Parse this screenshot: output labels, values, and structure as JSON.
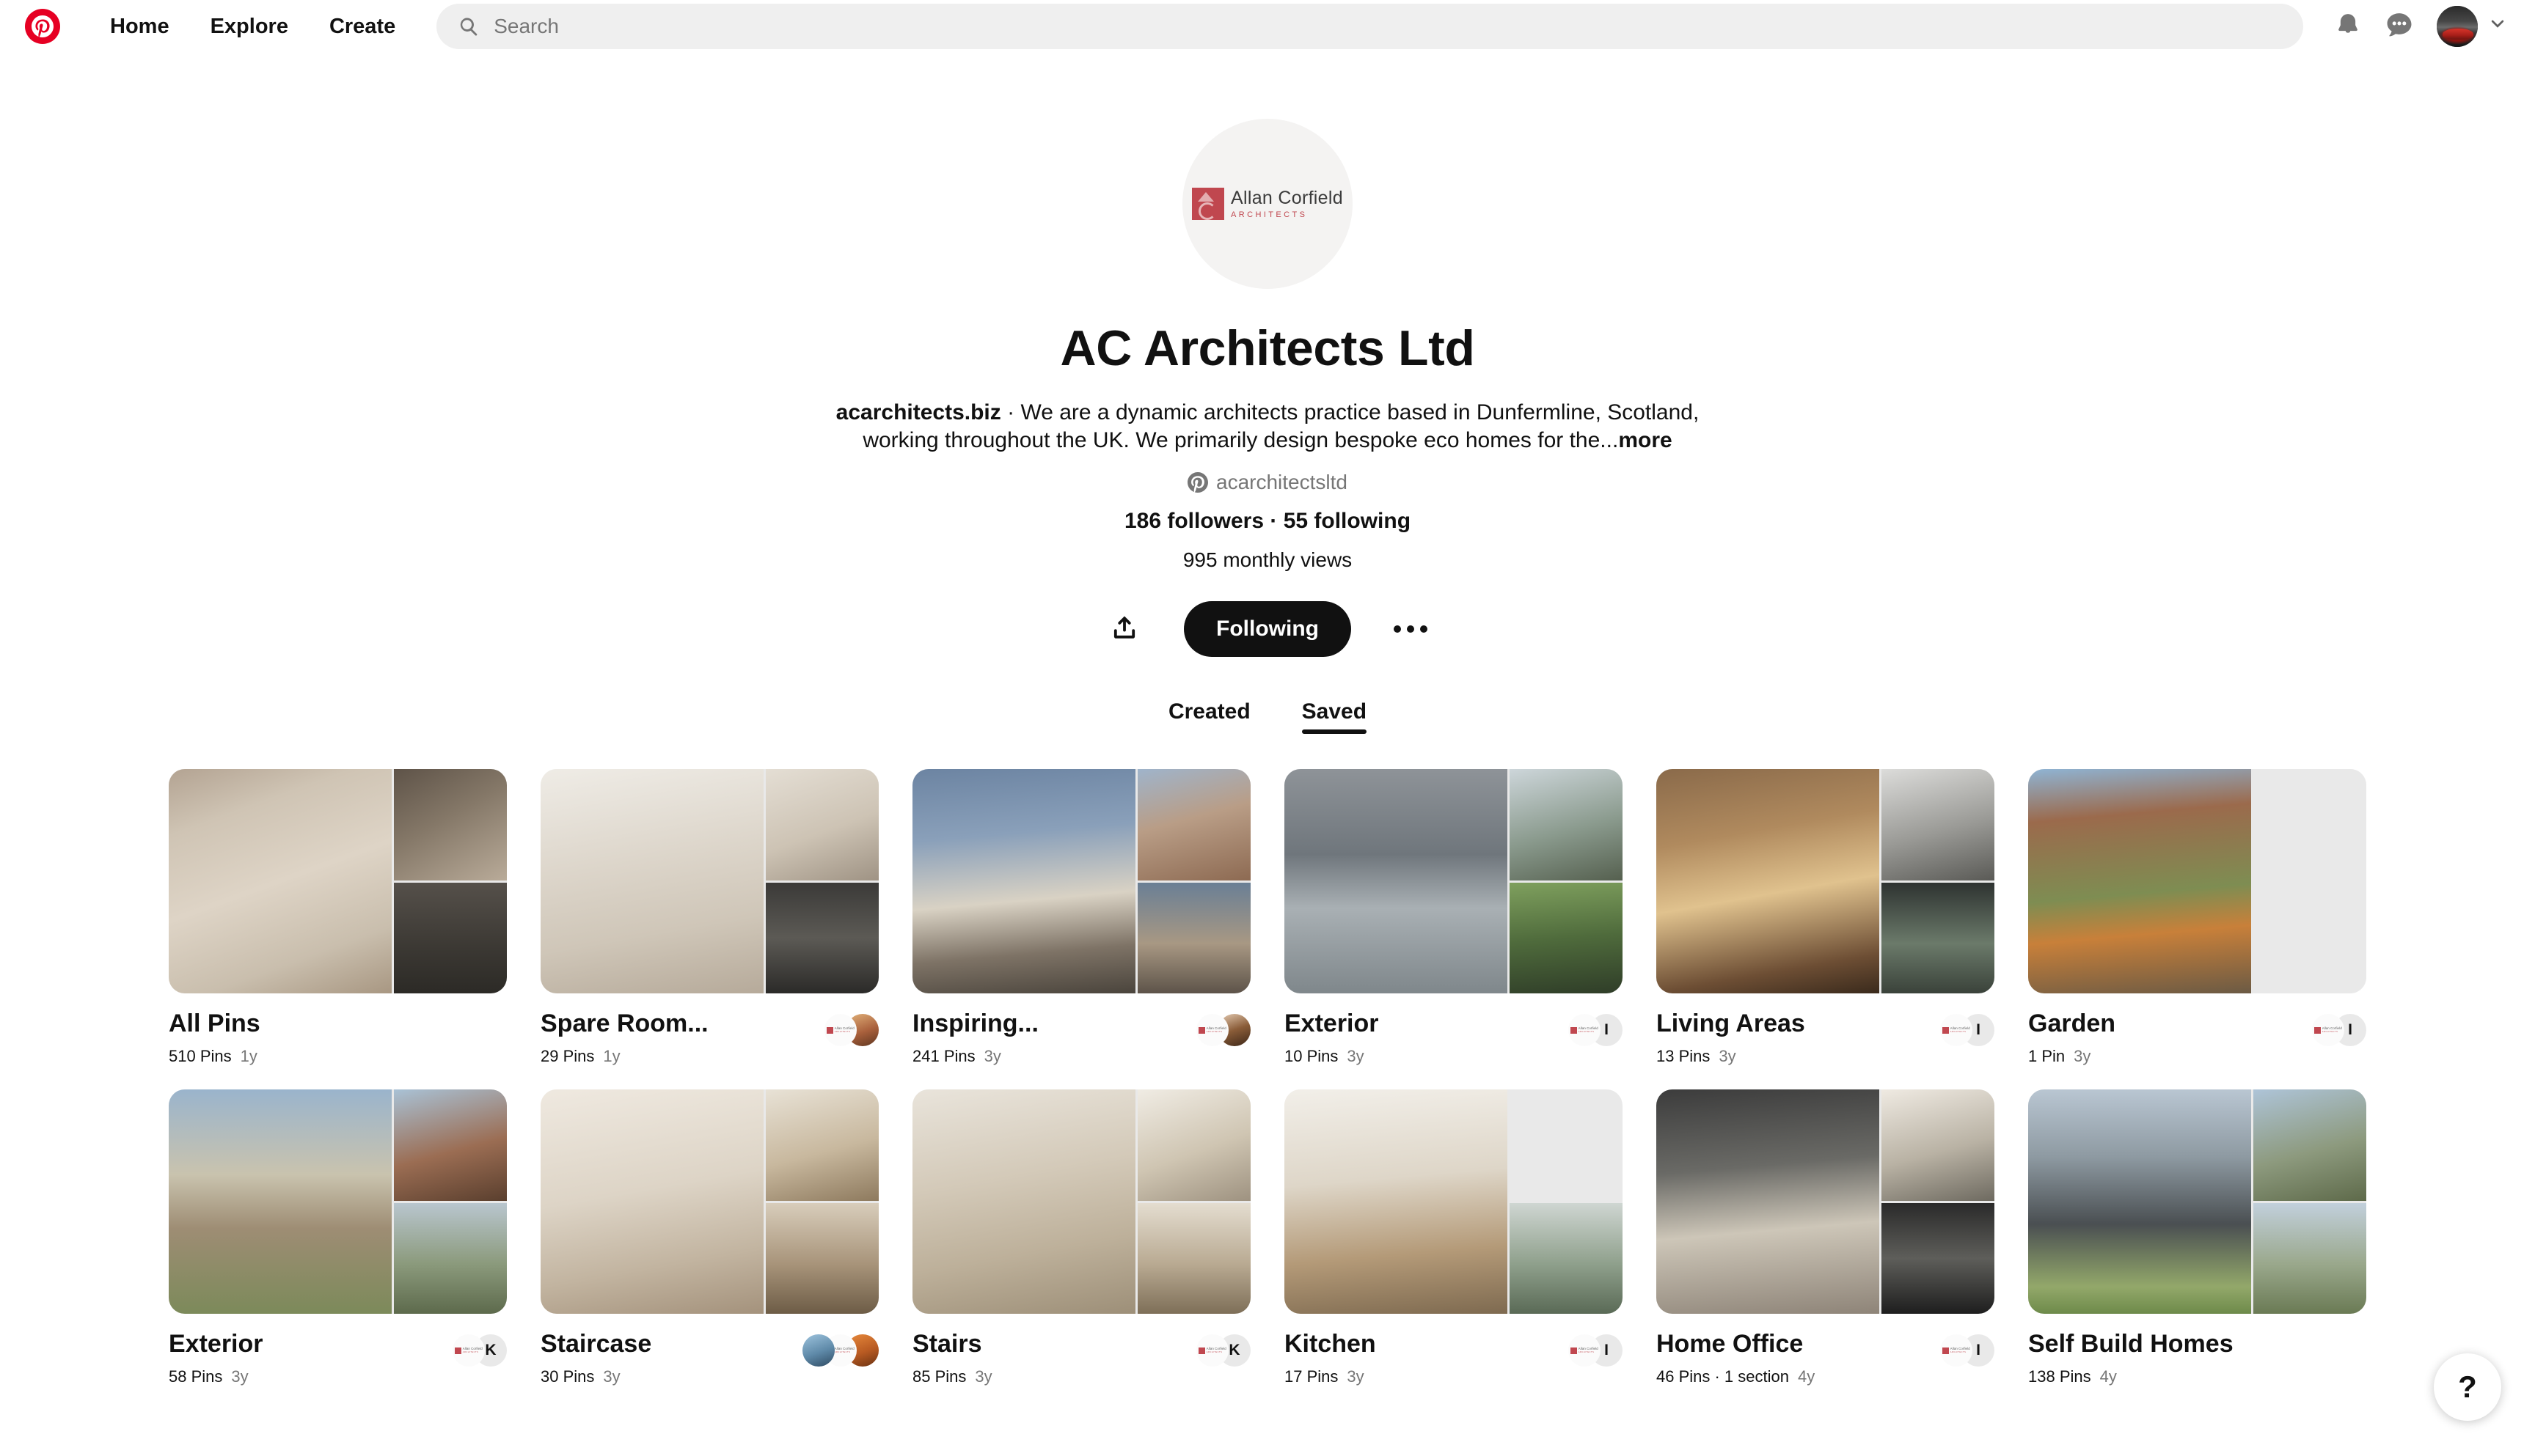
{
  "header": {
    "logo_icon": "pinterest-logo-icon",
    "nav": [
      {
        "label": "Home"
      },
      {
        "label": "Explore"
      },
      {
        "label": "Create"
      }
    ],
    "search": {
      "placeholder": "Search",
      "value": "",
      "icon": "search-icon"
    },
    "notifications_icon": "bell-icon",
    "messages_icon": "chat-bubble-icon",
    "account_chevron_icon": "chevron-down-icon",
    "avatar_alt": "user-avatar"
  },
  "profile": {
    "avatar_logo": {
      "name": "Allan Corfield",
      "subtitle": "ARCHITECTS",
      "mark_color": "#c0474f"
    },
    "name": "AC Architects Ltd",
    "website": "acarchitects.biz",
    "about_separator": " · ",
    "about": "We are a dynamic architects practice based in Dunfermline, Scotland, working throughout the UK. We primarily design bespoke eco homes for the...",
    "more_label": "more",
    "username": "acarchitectsltd",
    "username_icon": "pinterest-badge-icon",
    "stats": "186 followers · 55 following",
    "followers": "186 followers",
    "following": "55 following",
    "monthly_views": "995 monthly views",
    "actions": {
      "share_icon": "share-icon",
      "follow_label": "Following",
      "more_icon": "ellipsis-icon"
    }
  },
  "tabs": [
    {
      "label": "Created",
      "active": false
    },
    {
      "label": "Saved",
      "active": true
    }
  ],
  "boards": [
    {
      "title": "All Pins",
      "pins": "510 Pins",
      "age": "1y",
      "collaborators": [],
      "cover": {
        "main": "linear-gradient(160deg,#b3a392 0%,#cfc4b4 22%,#ded4c6 50%,#c9bead 78%,#a89782 100%)",
        "thumbs": [
          "linear-gradient(150deg,#5e5348 0%,#857868 45%,#b9ab99 100%)",
          "linear-gradient(180deg,#55504a 0%,#3b3833 60%,#2c2a26 100%)"
        ]
      }
    },
    {
      "title": "Spare Room...",
      "pins": "29 Pins",
      "age": "1y",
      "collaborators": [
        "logo",
        "photo-warm"
      ],
      "cover": {
        "main": "linear-gradient(170deg,#efece6 0%,#ddd6cb 40%,#cfc6b8 70%,#b6aa9a 100%)",
        "thumbs": [
          "linear-gradient(160deg,#e4ded4 0%,#cdc3b4 55%,#9f9384 100%)",
          "linear-gradient(180deg,#3b3a38 0%,#5c5a55 50%,#2b2a28 100%)"
        ]
      }
    },
    {
      "title": "Inspiring...",
      "pins": "241 Pins",
      "age": "3y",
      "collaborators": [
        "logo",
        "photo-hair"
      ],
      "cover": {
        "main": "linear-gradient(175deg,#6c84a2 0%,#8aa0ba 30%,#d9d2c4 58%,#7e7366 80%,#4a443c 100%)",
        "thumbs": [
          "linear-gradient(165deg,#9fb4cb 0%,#b99d86 45%,#8d6a52 100%)",
          "linear-gradient(180deg,#6a7f95 0%,#a89883 55%,#5d5349 100%)"
        ]
      }
    },
    {
      "title": "Exterior",
      "pins": "10 Pins",
      "age": "3y",
      "collaborators": [
        "logo",
        "letter-I"
      ],
      "cover": {
        "main": "linear-gradient(180deg,#8e9398 0%,#6f767c 38%,#a9b0b4 62%,#7f878b 100%)",
        "thumbs": [
          "linear-gradient(165deg,#cdd6da 0%,#8a9a8d 55%,#55604f 100%)",
          "linear-gradient(175deg,#7fa05e 0%,#4f6b3c 50%,#2f3d28 100%)"
        ]
      }
    },
    {
      "title": "Living Areas",
      "pins": "13 Pins",
      "age": "3y",
      "collaborators": [
        "logo",
        "letter-I"
      ],
      "cover": {
        "main": "linear-gradient(170deg,#8a6a4a 0%,#b08a5e 30%,#e0c28e 55%,#6d4e34 85%,#3a2a1c 100%)",
        "thumbs": [
          "linear-gradient(165deg,#dcdcda 0%,#9a9a96 55%,#5a5a56 100%)",
          "linear-gradient(180deg,#2e3331 0%,#6b7a6a 55%,#3a423a 100%)"
        ]
      }
    },
    {
      "title": "Garden",
      "pins": "1 Pin",
      "age": "3y",
      "collaborators": [
        "logo",
        "letter-I"
      ],
      "cover": {
        "main": "linear-gradient(175deg,#8fb4d4 0%,#9b6a4c 22%,#7e8d52 55%,#c8803a 72%,#6b5a44 100%)",
        "thumbs": [
          "empty",
          "empty"
        ]
      }
    },
    {
      "title": "Exterior",
      "pins": "58 Pins",
      "age": "3y",
      "collaborators": [
        "logo",
        "letter-K"
      ],
      "cover": {
        "main": "linear-gradient(180deg,#9ab4cc 0%,#c9c3ae 38%,#9e8d74 62%,#7c8a5a 100%)",
        "thumbs": [
          "linear-gradient(165deg,#a9c2d6 0%,#9b6d53 55%,#5a3f2e 100%)",
          "linear-gradient(180deg,#b9c6cf 0%,#8b9a7c 55%,#5d6a4c 100%)"
        ]
      }
    },
    {
      "title": "Staircase",
      "pins": "30 Pins",
      "age": "3y",
      "collaborators": [
        "photo-blue",
        "logo",
        "photo-orange"
      ],
      "cover": {
        "main": "linear-gradient(170deg,#efe9e0 0%,#ddd4c6 45%,#c2b4a0 75%,#a4927c 100%)",
        "thumbs": [
          "linear-gradient(165deg,#e8e2d6 0%,#c8b89e 55%,#8e7a5e 100%)",
          "linear-gradient(180deg,#d8cdbb 0%,#a8947a 55%,#6d5c46 100%)"
        ]
      }
    },
    {
      "title": "Stairs",
      "pins": "85 Pins",
      "age": "3y",
      "collaborators": [
        "logo",
        "letter-K"
      ],
      "cover": {
        "main": "linear-gradient(170deg,#e9e4db 0%,#d3c9b8 40%,#bdb09a 70%,#9d8f78 100%)",
        "thumbs": [
          "linear-gradient(160deg,#f0ece4 0%,#cfc5b2 55%,#9e9280 100%)",
          "linear-gradient(180deg,#e4ddd0 0%,#b9aa92 55%,#7e6f58 100%)"
        ]
      }
    },
    {
      "title": "Kitchen",
      "pins": "17 Pins",
      "age": "3y",
      "collaborators": [
        "logo",
        "letter-I"
      ],
      "cover": {
        "main": "linear-gradient(175deg,#f2efe9 0%,#ded6c8 40%,#b49a78 72%,#7e6a50 100%)",
        "thumbs": [
          "linear-gradient(165deg,#e2dbcd 0%,#b7a territory 0%,#9a8straw 0%,#8d7a5e 100%)",
          "linear-gradient(180deg,#cfd6d2 0%,#8fa08c 55%,#5a6a56 100%)"
        ]
      }
    },
    {
      "title": "Home Office",
      "pins": "46 Pins · 1 section",
      "age": "4y",
      "collaborators": [
        "logo",
        "letter-I"
      ],
      "cover": {
        "main": "linear-gradient(175deg,#3c3c3c 0%,#6a6a66 35%,#cdc6b8 62%,#8e8478 100%)",
        "thumbs": [
          "linear-gradient(165deg,#efeae2 0%,#b9b2a4 55%,#6e6a60 100%)",
          "linear-gradient(180deg,#2a2a2a 0%,#5e5e5a 50%,#1e1e1e 100%)"
        ]
      }
    },
    {
      "title": "Self Build Homes",
      "pins": "138 Pins",
      "age": "4y",
      "collaborators": [],
      "cover": {
        "main": "linear-gradient(180deg,#b9c6d2 0%,#8e9aa2 30%,#4a4f52 60%,#93a86a 88%,#6d8a4a 100%)",
        "thumbs": [
          "linear-gradient(165deg,#aec4d8 0%,#8d9a7e 55%,#5e6a4a 100%)",
          "linear-gradient(180deg,#c2d0dc 0%,#9aa88c 55%,#6a7a54 100%)"
        ]
      }
    }
  ],
  "help": {
    "label": "?"
  }
}
